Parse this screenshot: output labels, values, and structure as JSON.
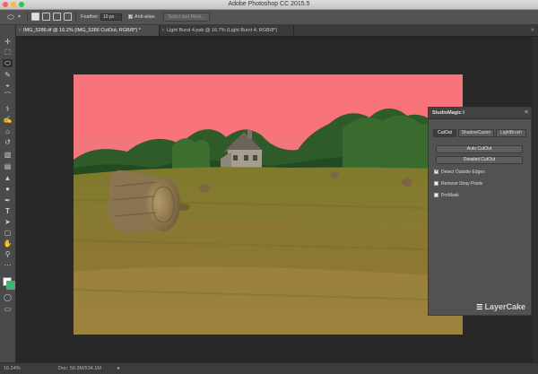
{
  "window": {
    "title": "Adobe Photoshop CC 2015.5",
    "traffic_lights": [
      "#ff5f57",
      "#febc2e",
      "#28c840"
    ]
  },
  "options_bar": {
    "tool_icon": "lasso-icon",
    "feather_label": "Feather:",
    "feather_value": "10 px",
    "antialias_label": "Anti-alias",
    "antialias_checked": true,
    "select_mask_label": "Select and Mask..."
  },
  "tabs": [
    {
      "label": "IMG_5286.tif @ 16.2% (IMG_5286 CutOut, RGB/8*) *",
      "active": true
    },
    {
      "label": "Light Burst 4.psb @ 16.7% (Light Burst 4, RGB/8*)",
      "active": false
    }
  ],
  "tools": [
    "move-icon",
    "marquee-icon",
    "lasso-icon",
    "quick-select-icon",
    "crop-icon",
    "eyedropper-icon",
    "healing-icon",
    "brush-icon",
    "stamp-icon",
    "history-brush-icon",
    "eraser-icon",
    "gradient-icon",
    "blur-icon",
    "dodge-icon",
    "pen-icon",
    "type-icon",
    "path-select-icon",
    "shape-icon",
    "hand-icon",
    "zoom-icon",
    "more-icon"
  ],
  "panel": {
    "title": "StudioMagic I",
    "tabs": [
      {
        "label": "CutOut",
        "active": true
      },
      {
        "label": "ShadowCaster",
        "active": false
      },
      {
        "label": "LightBrush",
        "active": false
      }
    ],
    "buttons": [
      "Auto CutOut",
      "Detailed CutOut"
    ],
    "checkboxes": [
      {
        "label": "Detect Outside Edges",
        "checked": true
      },
      {
        "label": "Remove Stray Pixels",
        "checked": false
      },
      {
        "label": "ProMask",
        "checked": false
      }
    ],
    "brand": "LayerCake"
  },
  "status": {
    "zoom": "16.24%",
    "doc": "Doc: 50.3M/534.1M"
  }
}
